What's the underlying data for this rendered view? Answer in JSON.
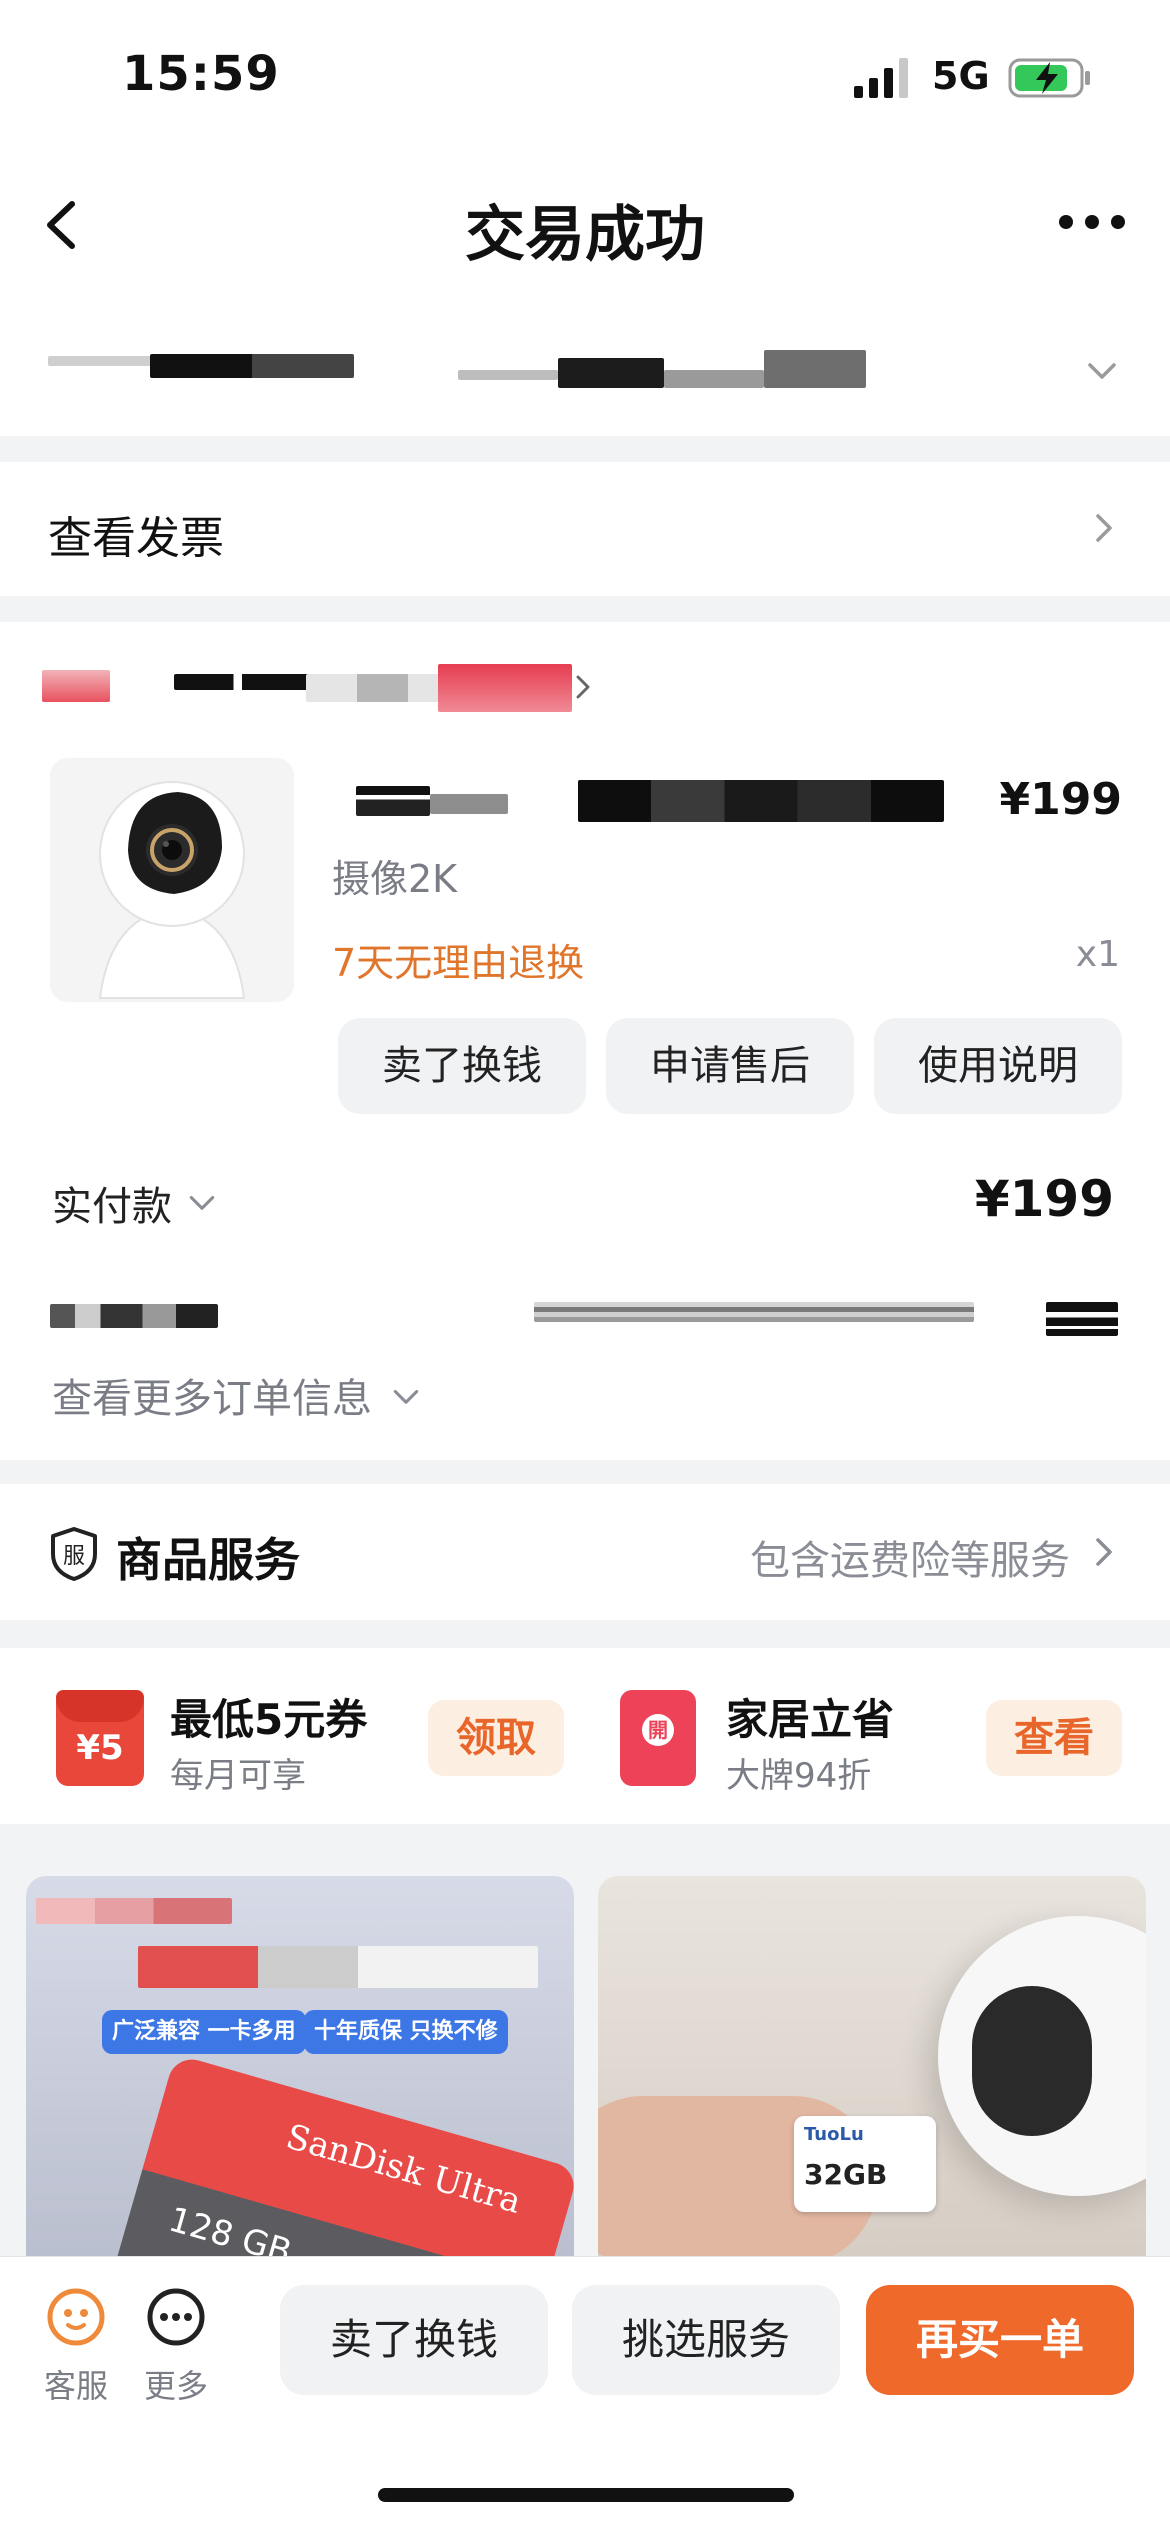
{
  "status_bar": {
    "time": "15:59",
    "network": "5G"
  },
  "nav": {
    "title": "交易成功"
  },
  "invoice": {
    "label": "查看发票"
  },
  "product": {
    "price": "¥199",
    "spec": "摄像2K",
    "return_policy": "7天无理由退换",
    "quantity": "x1",
    "actions": [
      "卖了换钱",
      "申请售后",
      "使用说明"
    ]
  },
  "payment": {
    "paid_label": "实付款",
    "paid_amount": "¥199",
    "more_info": "查看更多订单信息"
  },
  "service": {
    "badge": "服",
    "title": "商品服务",
    "description": "包含运费险等服务"
  },
  "coupons": [
    {
      "icon_text": "¥5",
      "title": "最低5元券",
      "subtitle": "每月可享",
      "button": "领取"
    },
    {
      "icon_text": "開",
      "title": "家居立省",
      "subtitle": "大牌94折",
      "button": "查看"
    }
  ],
  "recommendations": {
    "card1": {
      "tag1": "广泛兼容 一卡多用",
      "tag2": "十年质保 只换不修",
      "brand": "SanDisk Ultra",
      "capacity": "128 GB"
    },
    "card2": {
      "brand": "TuoLu",
      "capacity": "32GB"
    }
  },
  "bottom_bar": {
    "service_label": "客服",
    "more_label": "更多",
    "sell_label": "卖了换钱",
    "choose_service_label": "挑选服务",
    "buy_again_label": "再买一单"
  },
  "colors": {
    "accent_orange": "#ef6a2a",
    "return_orange": "#e0762c",
    "coupon_red": "#e8473a"
  }
}
